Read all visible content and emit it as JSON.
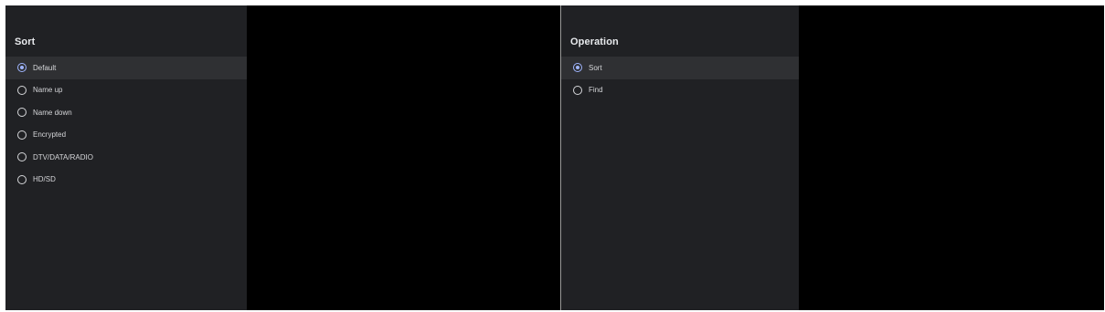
{
  "sort_menu": {
    "title": "Sort",
    "options": [
      {
        "label": "Default",
        "selected": true
      },
      {
        "label": "Name up",
        "selected": false
      },
      {
        "label": "Name down",
        "selected": false
      },
      {
        "label": "Encrypted",
        "selected": false
      },
      {
        "label": "DTV/DATA/RADIO",
        "selected": false
      },
      {
        "label": "HD/SD",
        "selected": false
      }
    ]
  },
  "operation_menu": {
    "title": "Operation",
    "options": [
      {
        "label": "Sort",
        "selected": true
      },
      {
        "label": "Find",
        "selected": false
      }
    ]
  },
  "colors": {
    "panel_bg": "#202124",
    "selected_row_bg": "#2f3033",
    "accent": "#9fb5ff",
    "screen_bg": "#000000"
  }
}
